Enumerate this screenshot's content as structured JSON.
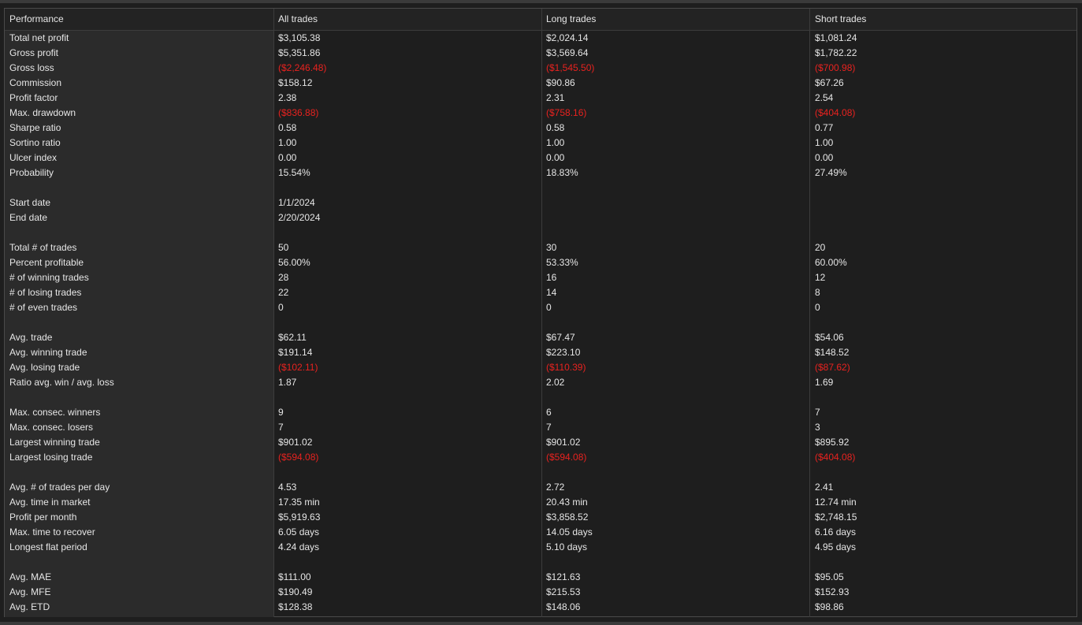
{
  "header": {
    "performance": "Performance",
    "all": "All trades",
    "long": "Long trades",
    "short": "Short trades"
  },
  "colors": {
    "negative": "#e8221f",
    "text": "#e6e6e6",
    "background": "#1e1e1e",
    "label_column": "#2b2b2b"
  },
  "rows": [
    {
      "label": "Total net profit",
      "all": "$3,105.38",
      "long": "$2,024.14",
      "short": "$1,081.24"
    },
    {
      "label": "Gross profit",
      "all": "$5,351.86",
      "long": "$3,569.64",
      "short": "$1,782.22"
    },
    {
      "label": "Gross loss",
      "all": "($2,246.48)",
      "long": "($1,545.50)",
      "short": "($700.98)",
      "negative": true
    },
    {
      "label": "Commission",
      "all": "$158.12",
      "long": "$90.86",
      "short": "$67.26"
    },
    {
      "label": "Profit factor",
      "all": "2.38",
      "long": "2.31",
      "short": "2.54"
    },
    {
      "label": "Max. drawdown",
      "all": "($836.88)",
      "long": "($758.16)",
      "short": "($404.08)",
      "negative": true
    },
    {
      "label": "Sharpe ratio",
      "all": "0.58",
      "long": "0.58",
      "short": "0.77"
    },
    {
      "label": "Sortino ratio",
      "all": "1.00",
      "long": "1.00",
      "short": "1.00"
    },
    {
      "label": "Ulcer index",
      "all": "0.00",
      "long": "0.00",
      "short": "0.00"
    },
    {
      "label": "Probability",
      "all": "15.54%",
      "long": "18.83%",
      "short": "27.49%"
    },
    {
      "label": "",
      "all": "",
      "long": "",
      "short": ""
    },
    {
      "label": "Start date",
      "all": "1/1/2024",
      "long": "",
      "short": ""
    },
    {
      "label": "End date",
      "all": "2/20/2024",
      "long": "",
      "short": ""
    },
    {
      "label": "",
      "all": "",
      "long": "",
      "short": ""
    },
    {
      "label": "Total # of trades",
      "all": "50",
      "long": "30",
      "short": "20"
    },
    {
      "label": "Percent profitable",
      "all": "56.00%",
      "long": "53.33%",
      "short": "60.00%"
    },
    {
      "label": "# of winning trades",
      "all": "28",
      "long": "16",
      "short": "12"
    },
    {
      "label": "# of losing trades",
      "all": "22",
      "long": "14",
      "short": "8"
    },
    {
      "label": "# of even trades",
      "all": "0",
      "long": "0",
      "short": "0"
    },
    {
      "label": "",
      "all": "",
      "long": "",
      "short": ""
    },
    {
      "label": "Avg. trade",
      "all": "$62.11",
      "long": "$67.47",
      "short": "$54.06"
    },
    {
      "label": "Avg. winning trade",
      "all": "$191.14",
      "long": "$223.10",
      "short": "$148.52"
    },
    {
      "label": "Avg. losing trade",
      "all": "($102.11)",
      "long": "($110.39)",
      "short": "($87.62)",
      "negative": true
    },
    {
      "label": "Ratio avg. win / avg. loss",
      "all": "1.87",
      "long": "2.02",
      "short": "1.69"
    },
    {
      "label": "",
      "all": "",
      "long": "",
      "short": ""
    },
    {
      "label": "Max. consec. winners",
      "all": "9",
      "long": "6",
      "short": "7"
    },
    {
      "label": "Max. consec. losers",
      "all": "7",
      "long": "7",
      "short": "3"
    },
    {
      "label": "Largest winning trade",
      "all": "$901.02",
      "long": "$901.02",
      "short": "$895.92"
    },
    {
      "label": "Largest losing trade",
      "all": "($594.08)",
      "long": "($594.08)",
      "short": "($404.08)",
      "negative": true
    },
    {
      "label": "",
      "all": "",
      "long": "",
      "short": ""
    },
    {
      "label": "Avg. # of trades per day",
      "all": "4.53",
      "long": "2.72",
      "short": "2.41"
    },
    {
      "label": "Avg. time in market",
      "all": "17.35 min",
      "long": "20.43 min",
      "short": "12.74 min"
    },
    {
      "label": "Profit per month",
      "all": "$5,919.63",
      "long": "$3,858.52",
      "short": "$2,748.15"
    },
    {
      "label": "Max. time to recover",
      "all": "6.05 days",
      "long": "14.05 days",
      "short": "6.16 days"
    },
    {
      "label": "Longest flat period",
      "all": "4.24 days",
      "long": "5.10 days",
      "short": "4.95 days"
    },
    {
      "label": "",
      "all": "",
      "long": "",
      "short": ""
    },
    {
      "label": "Avg. MAE",
      "all": "$111.00",
      "long": "$121.63",
      "short": "$95.05"
    },
    {
      "label": "Avg. MFE",
      "all": "$190.49",
      "long": "$215.53",
      "short": "$152.93"
    },
    {
      "label": "Avg. ETD",
      "all": "$128.38",
      "long": "$148.06",
      "short": "$98.86"
    }
  ]
}
